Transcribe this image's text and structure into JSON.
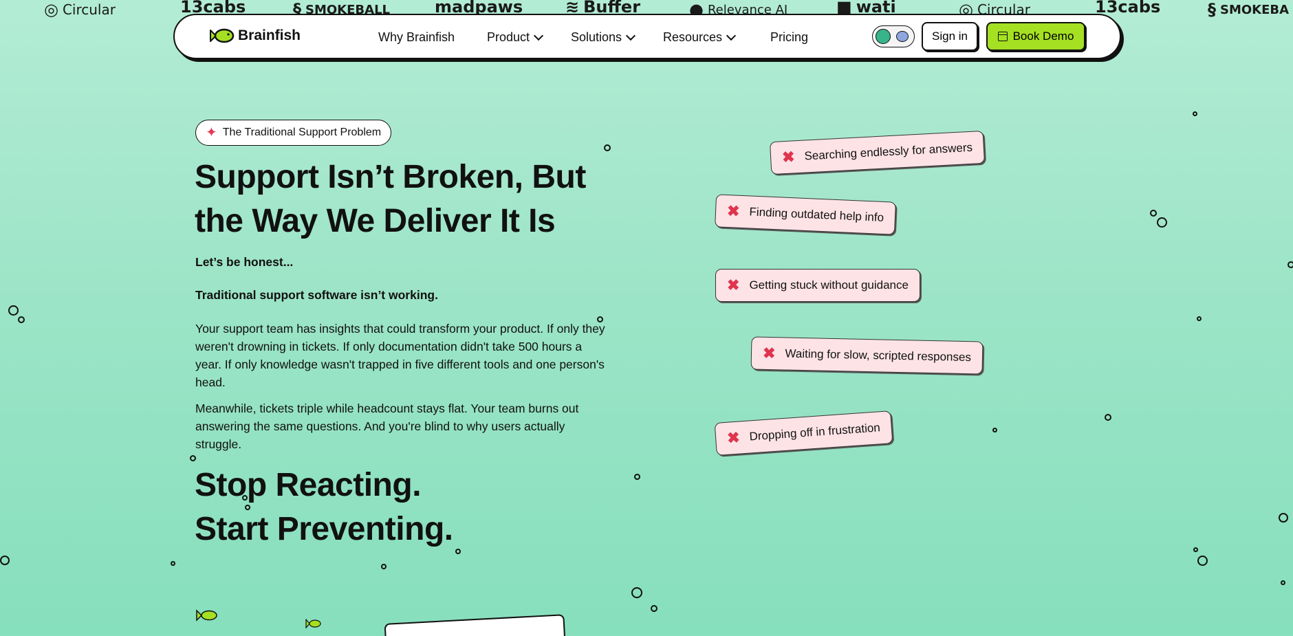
{
  "logos": [
    {
      "name": "Circular",
      "icon": "circular-logo-icon"
    },
    {
      "name": "13cabs",
      "icon": ""
    },
    {
      "name": "SMOKEBALL",
      "icon": "smokeball-logo-icon"
    },
    {
      "name": "madpaws",
      "icon": ""
    },
    {
      "name": "Buffer",
      "icon": "buffer-logo-icon"
    },
    {
      "name": "Relevance AI",
      "icon": "relevance-logo-icon"
    },
    {
      "name": "wati",
      "icon": "wati-logo-icon"
    },
    {
      "name": "Circular",
      "icon": "circular-logo-icon"
    },
    {
      "name": "13cabs",
      "icon": ""
    },
    {
      "name": "SMOKEBA",
      "icon": "smokeball-logo-icon"
    }
  ],
  "nav": {
    "brand": "Brainfish",
    "links": [
      "Why Brainfish",
      "Product",
      "Solutions",
      "Resources",
      "Pricing"
    ],
    "signin": "Sign in",
    "demo": "Book Demo"
  },
  "hero": {
    "pill": "The Traditional Support Problem",
    "title_line1": "Support Isn’t Broken, But",
    "title_line2": "the Way We Deliver It Is",
    "p1": "Let’s be honest...",
    "p2": "Traditional support software isn’t working.",
    "p3": "Your support team has insights that could transform your product. If only they weren't drowning in tickets. If only documentation didn't take 500 hours a year. If only knowledge wasn't trapped in five different tools and one person's head.",
    "p4": "Meanwhile, tickets triple while headcount stays flat. Your team burns out answering the same questions. And you're blind to why users actually struggle.",
    "cta_line1": "Stop Reacting.",
    "cta_line2": "Start Preventing."
  },
  "problems": [
    "Searching endlessly for answers",
    "Finding outdated help info",
    "Getting stuck without guidance",
    "Waiting for slow, scripted responses",
    "Dropping off in frustration"
  ],
  "colors": {
    "accent": "#a5e022",
    "problem_bg": "#fde3e6",
    "x_mark": "#e0344e"
  }
}
